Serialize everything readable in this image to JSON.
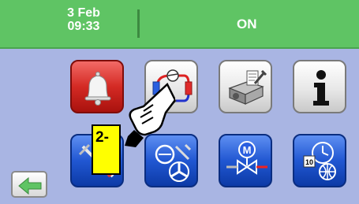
{
  "header": {
    "date": "3 Feb",
    "time": "09:33",
    "status": "ON",
    "bg_color": "#5fc464"
  },
  "tiles": [
    {
      "icon": "alarm-bell-icon",
      "style": "red"
    },
    {
      "icon": "refrigeration-circuit-icon",
      "style": "white"
    },
    {
      "icon": "unit-settings-icon",
      "style": "white"
    },
    {
      "icon": "info-icon",
      "style": "white"
    },
    {
      "icon": "tools-icon",
      "style": "blue"
    },
    {
      "icon": "compressor-fan-settings-icon",
      "style": "blue"
    },
    {
      "icon": "motor-valve-icon",
      "style": "blue"
    },
    {
      "icon": "calendar-clock-globe-icon",
      "style": "blue"
    }
  ],
  "nav": {
    "back_icon": "left-arrow-icon"
  },
  "annotation": {
    "step_label": "2-",
    "pointer_icon": "pointing-hand-icon"
  }
}
